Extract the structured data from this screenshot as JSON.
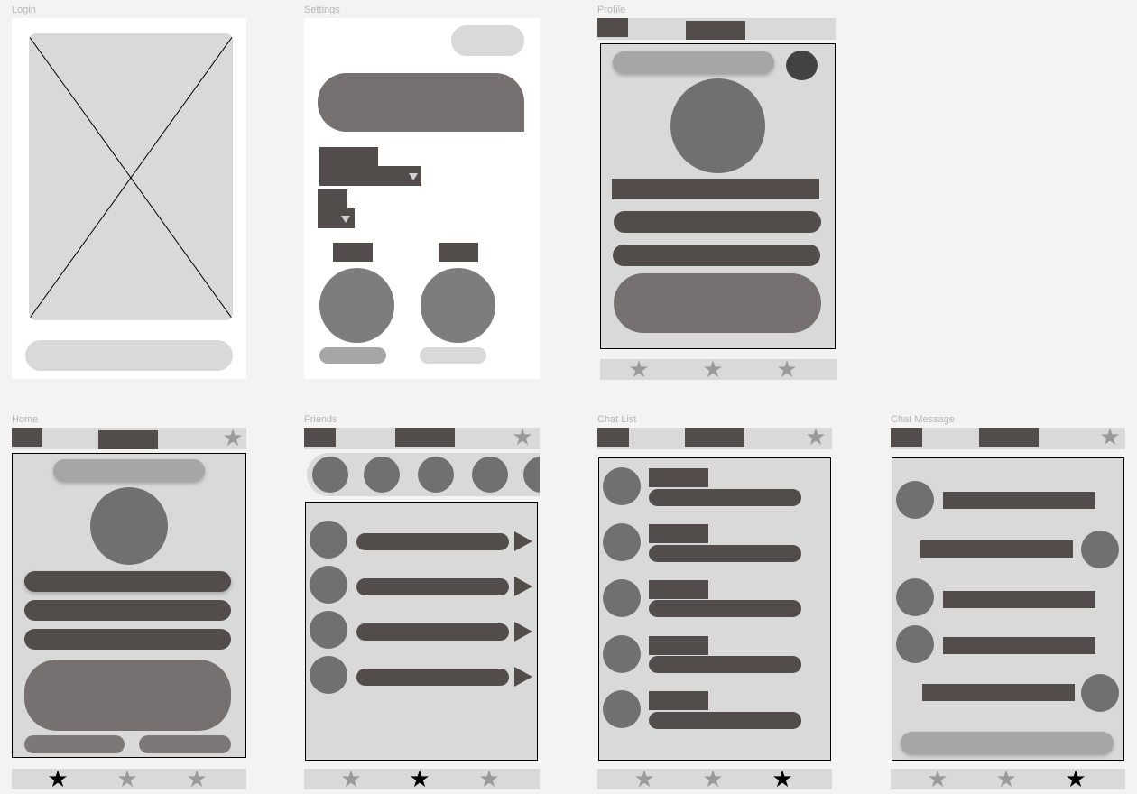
{
  "frames": {
    "login": "Login",
    "settings": "Settings",
    "profile": "Profile",
    "home": "Home",
    "friends": "Friends",
    "chat_list": "Chat List",
    "chat_message": "Chat Message"
  },
  "icons": {
    "star": "★",
    "tab_star": "star-icon"
  },
  "colors": {
    "canvas": "#f3f3f3",
    "frame": "#ffffff",
    "placeholder_light": "#d9d9d9",
    "placeholder_dark": "#524d4b",
    "placeholder_mid": "#767070",
    "placeholder_gray": "#a6a6a6",
    "avatar": "#707070",
    "tab_inactive": "#9a9a9a",
    "tab_active": "#000000"
  },
  "tabbars": {
    "profile_active": null,
    "home_active": 1,
    "friends_active": 2,
    "chat_list_active": 3,
    "chat_message_active": 3
  }
}
